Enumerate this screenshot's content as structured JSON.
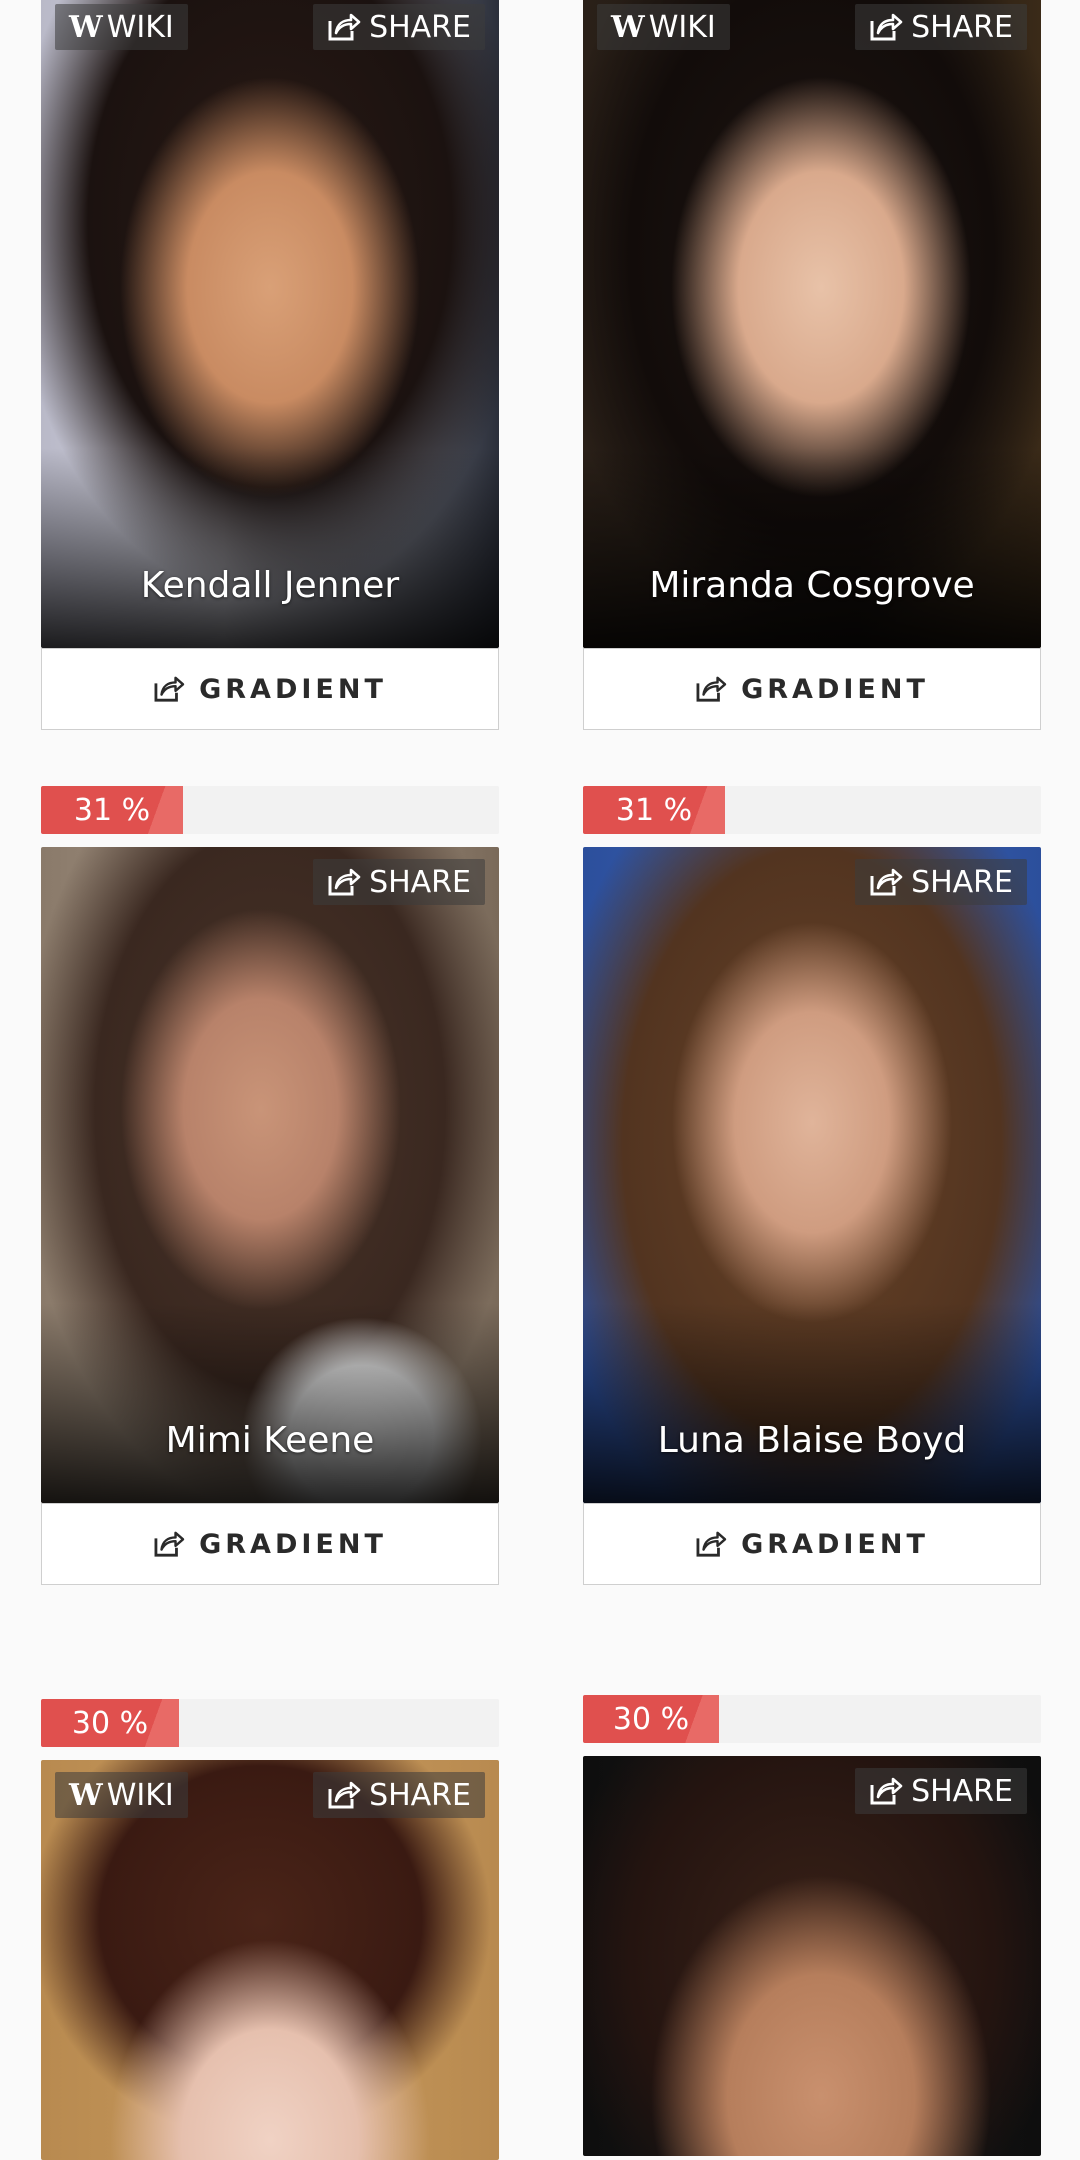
{
  "labels": {
    "wiki": "WIKI",
    "share": "SHARE",
    "gradient": "GRADIENT"
  },
  "icons": {
    "wiki": "wikipedia-w-icon",
    "share": "share-arrow-icon"
  },
  "colors": {
    "progress_fill": "#e0504e",
    "progress_track": "#f2f2f2"
  },
  "cards": [
    {
      "name": "Kendall Jenner",
      "percent_text": "",
      "percent": null
    },
    {
      "name": "Miranda Cosgrove",
      "percent_text": "",
      "percent": null
    },
    {
      "name": "Mimi Keene",
      "percent_text": "31 %",
      "percent": 31
    },
    {
      "name": "Luna Blaise Boyd",
      "percent_text": "31 %",
      "percent": 31
    },
    {
      "name": "",
      "percent_text": "30 %",
      "percent": 30
    },
    {
      "name": "",
      "percent_text": "30 %",
      "percent": 30
    }
  ]
}
